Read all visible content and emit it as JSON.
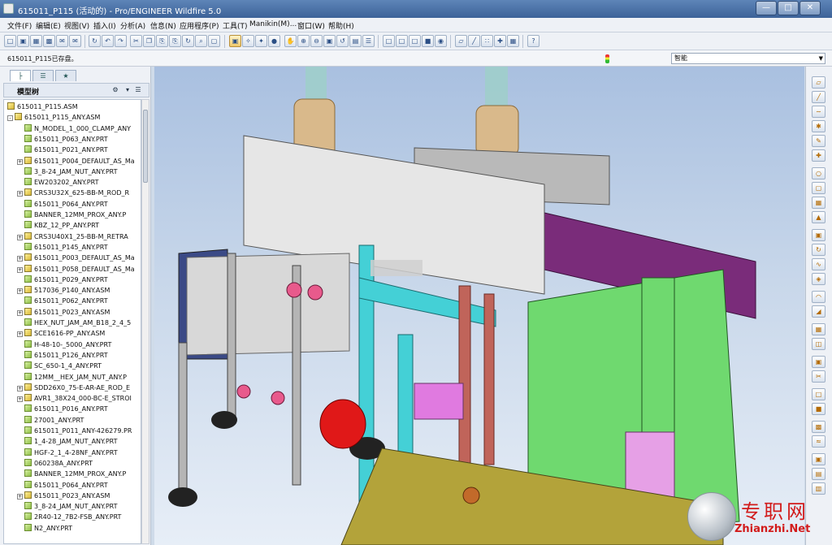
{
  "window": {
    "title": "615011_P115 (活动的) - Pro/ENGINEER Wildfire 5.0"
  },
  "menu": [
    "文件(F)",
    "编辑(E)",
    "视图(V)",
    "插入(I)",
    "分析(A)",
    "信息(N)",
    "应用程序(P)",
    "工具(T)",
    "Manikin(M)...",
    "窗口(W)",
    "帮助(H)"
  ],
  "message": "615011_P115已存盘。",
  "filter": {
    "value": "智能"
  },
  "left_panel": {
    "tabs": [
      "model-tree",
      "layers",
      "favorites"
    ],
    "tree_title": "模型树",
    "tree": [
      {
        "label": "615011_P115.ASM",
        "type": "asm",
        "level": 0,
        "expand": ""
      },
      {
        "label": "615011_P115_ANY.ASM",
        "type": "asm",
        "level": 1,
        "expand": "-"
      },
      {
        "label": "N_MODEL_1_000_CLAMP_ANY",
        "type": "prt",
        "level": 2,
        "expand": ""
      },
      {
        "label": "615011_P063_ANY.PRT",
        "type": "prt",
        "level": 2,
        "expand": ""
      },
      {
        "label": "615011_P021_ANY.PRT",
        "type": "prt",
        "level": 2,
        "expand": ""
      },
      {
        "label": "615011_P004_DEFAULT_AS_Ma",
        "type": "asm",
        "level": 2,
        "expand": "+"
      },
      {
        "label": "3_8-24_JAM_NUT_ANY.PRT",
        "type": "prt",
        "level": 2,
        "expand": ""
      },
      {
        "label": "EW203202_ANY.PRT",
        "type": "prt",
        "level": 2,
        "expand": ""
      },
      {
        "label": "CRS3U32X_625-BB-M_ROD_R",
        "type": "asm",
        "level": 2,
        "expand": "+"
      },
      {
        "label": "615011_P064_ANY.PRT",
        "type": "prt",
        "level": 2,
        "expand": ""
      },
      {
        "label": "BANNER_12MM_PROX_ANY.P",
        "type": "prt",
        "level": 2,
        "expand": ""
      },
      {
        "label": "KBZ_12_PP_ANY.PRT",
        "type": "prt",
        "level": 2,
        "expand": ""
      },
      {
        "label": "CRS3U40X1_25-BB-M_RETRA",
        "type": "asm",
        "level": 2,
        "expand": "+"
      },
      {
        "label": "615011_P145_ANY.PRT",
        "type": "prt",
        "level": 2,
        "expand": ""
      },
      {
        "label": "615011_P003_DEFAULT_AS_Ma",
        "type": "asm",
        "level": 2,
        "expand": "+"
      },
      {
        "label": "615011_P058_DEFAULT_AS_Ma",
        "type": "asm",
        "level": 2,
        "expand": "+"
      },
      {
        "label": "615011_P029_ANY.PRT",
        "type": "prt",
        "level": 2,
        "expand": ""
      },
      {
        "label": "517036_P140_ANY.ASM",
        "type": "asm",
        "level": 2,
        "expand": "+"
      },
      {
        "label": "615011_P062_ANY.PRT",
        "type": "prt",
        "level": 2,
        "expand": ""
      },
      {
        "label": "615011_P023_ANY.ASM",
        "type": "asm",
        "level": 2,
        "expand": "+"
      },
      {
        "label": "HEX_NUT_JAM_AM_B18_2_4_5",
        "type": "prt",
        "level": 2,
        "expand": ""
      },
      {
        "label": "SCE1616-PP_ANY.ASM",
        "type": "asm",
        "level": 2,
        "expand": "+"
      },
      {
        "label": "H-48-10-_5000_ANY.PRT",
        "type": "prt",
        "level": 2,
        "expand": ""
      },
      {
        "label": "615011_P126_ANY.PRT",
        "type": "prt",
        "level": 2,
        "expand": ""
      },
      {
        "label": "SC_650-1_4_ANY.PRT",
        "type": "prt",
        "level": 2,
        "expand": ""
      },
      {
        "label": "12MM__HEX_JAM_NUT_ANY.P",
        "type": "prt",
        "level": 2,
        "expand": ""
      },
      {
        "label": "SDD26X0_75-E-AR-AE_ROD_E",
        "type": "asm",
        "level": 2,
        "expand": "+"
      },
      {
        "label": "AVR1_38X24_000-BC-E_STROI",
        "type": "asm",
        "level": 2,
        "expand": "+"
      },
      {
        "label": "615011_P016_ANY.PRT",
        "type": "prt",
        "level": 2,
        "expand": ""
      },
      {
        "label": "27001_ANY.PRT",
        "type": "prt",
        "level": 2,
        "expand": ""
      },
      {
        "label": "615011_P011_ANY-426279.PR",
        "type": "prt",
        "level": 2,
        "expand": ""
      },
      {
        "label": "1_4-28_JAM_NUT_ANY.PRT",
        "type": "prt",
        "level": 2,
        "expand": ""
      },
      {
        "label": "HGF-2_1_4-28NF_ANY.PRT",
        "type": "prt",
        "level": 2,
        "expand": ""
      },
      {
        "label": "060238A_ANY.PRT",
        "type": "prt",
        "level": 2,
        "expand": ""
      },
      {
        "label": "BANNER_12MM_PROX_ANY.P",
        "type": "prt",
        "level": 2,
        "expand": ""
      },
      {
        "label": "615011_P064_ANY.PRT",
        "type": "prt",
        "level": 2,
        "expand": ""
      },
      {
        "label": "615011_P023_ANY.ASM",
        "type": "asm",
        "level": 2,
        "expand": "+"
      },
      {
        "label": "3_8-24_JAM_NUT_ANY.PRT",
        "type": "prt",
        "level": 2,
        "expand": ""
      },
      {
        "label": "2R40-12_7B2-FSB_ANY.PRT",
        "type": "prt",
        "level": 2,
        "expand": ""
      },
      {
        "label": "N2_ANY.PRT",
        "type": "prt",
        "level": 2,
        "expand": ""
      }
    ]
  },
  "watermark": {
    "cn": "专职网",
    "url": "Zhianzhi.Net"
  },
  "colors": {
    "accent": "#3c6298",
    "viewport_top": "#a9c0e0",
    "viewport_bottom": "#e7eef7"
  }
}
